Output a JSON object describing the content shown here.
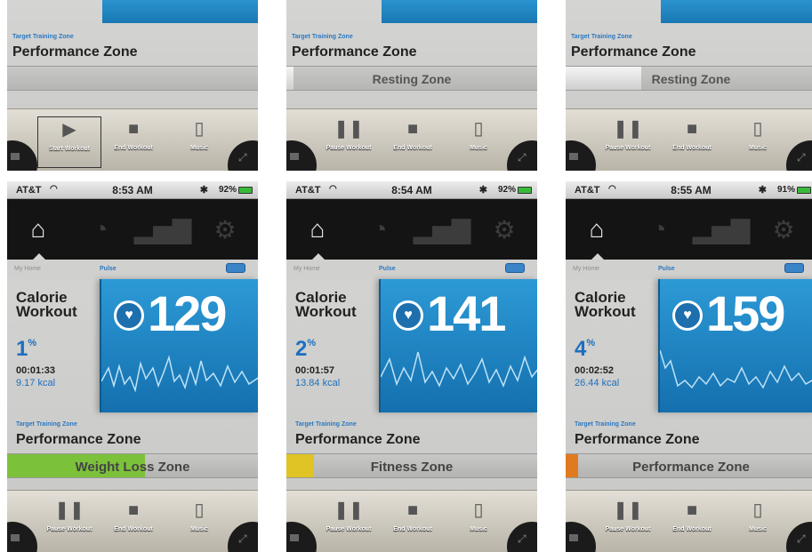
{
  "top_panels": [
    {
      "target_zone_label": "Target Training Zone",
      "performance_label": "Performance Zone",
      "zone_name": "",
      "zone_fill": 0,
      "buttons": [
        {
          "icon": "play-icon",
          "glyph": "▶",
          "label": "Start Workout"
        },
        {
          "icon": "stop-icon",
          "glyph": "■",
          "label": "End Workout"
        },
        {
          "icon": "ipod-icon",
          "glyph": "▯",
          "label": "Music"
        }
      ]
    },
    {
      "target_zone_label": "Target Training Zone",
      "performance_label": "Performance Zone",
      "zone_name": "Resting Zone",
      "zone_fill": 0.03,
      "buttons": [
        {
          "icon": "pause-icon",
          "glyph": "❚❚",
          "label": "Pause Workout"
        },
        {
          "icon": "stop-icon",
          "glyph": "■",
          "label": "End Workout"
        },
        {
          "icon": "ipod-icon",
          "glyph": "▯",
          "label": "Music"
        }
      ]
    },
    {
      "target_zone_label": "Target Training Zone",
      "performance_label": "Performance Zone",
      "zone_name": "Resting Zone",
      "zone_fill": 0.3,
      "buttons": [
        {
          "icon": "pause-icon",
          "glyph": "❚❚",
          "label": "Pause Workout"
        },
        {
          "icon": "stop-icon",
          "glyph": "■",
          "label": "End Workout"
        },
        {
          "icon": "ipod-icon",
          "glyph": "▯",
          "label": "Music"
        }
      ]
    }
  ],
  "screens": [
    {
      "carrier": "AT&T",
      "time": "8:53 AM",
      "battery": "92%",
      "my_home": "My Home",
      "pulse_label": "Pulse",
      "workout_name": "Calorie Workout",
      "percent": "1",
      "elapsed": "00:01:33",
      "kcal": "9.17 kcal",
      "bpm": "129",
      "target_zone_label": "Target Training Zone",
      "performance_label": "Performance Zone",
      "zone_name": "Weight Loss Zone",
      "zone_fill": 0.55,
      "zone_color": "#7cc13a",
      "buttons": [
        {
          "icon": "pause-icon",
          "glyph": "❚❚",
          "label": "Pause Workout"
        },
        {
          "icon": "stop-icon",
          "glyph": "■",
          "label": "End Workout"
        },
        {
          "icon": "ipod-icon",
          "glyph": "▯",
          "label": "Music"
        }
      ]
    },
    {
      "carrier": "AT&T",
      "time": "8:54 AM",
      "battery": "92%",
      "my_home": "My Home",
      "pulse_label": "Pulse",
      "workout_name": "Calorie Workout",
      "percent": "2",
      "elapsed": "00:01:57",
      "kcal": "13.84 kcal",
      "bpm": "141",
      "target_zone_label": "Target Training Zone",
      "performance_label": "Performance Zone",
      "zone_name": "Fitness Zone",
      "zone_fill": 0.11,
      "zone_color": "#e0c324",
      "buttons": [
        {
          "icon": "pause-icon",
          "glyph": "❚❚",
          "label": "Pause Workout"
        },
        {
          "icon": "stop-icon",
          "glyph": "■",
          "label": "End Workout"
        },
        {
          "icon": "ipod-icon",
          "glyph": "▯",
          "label": "Music"
        }
      ]
    },
    {
      "carrier": "AT&T",
      "time": "8:55 AM",
      "battery": "91%",
      "my_home": "My Home",
      "pulse_label": "Pulse",
      "workout_name": "Calorie Workout",
      "percent": "4",
      "elapsed": "00:02:52",
      "kcal": "26.44 kcal",
      "bpm": "159",
      "target_zone_label": "Target Training Zone",
      "performance_label": "Performance Zone",
      "zone_name": "Performance Zone",
      "zone_fill": 0.05,
      "zone_color": "#e07a1f",
      "buttons": [
        {
          "icon": "pause-icon",
          "glyph": "❚❚",
          "label": "Pause Workout"
        },
        {
          "icon": "stop-icon",
          "glyph": "■",
          "label": "End Workout"
        },
        {
          "icon": "ipod-icon",
          "glyph": "▯",
          "label": "Music"
        }
      ]
    }
  ]
}
